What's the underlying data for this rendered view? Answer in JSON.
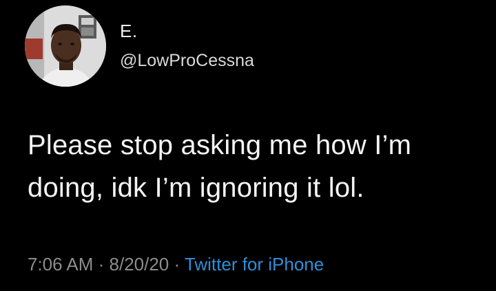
{
  "tweet": {
    "author": {
      "display_name": "E.",
      "handle": "@LowProCessna"
    },
    "text_lines": [
      "Please stop asking me how I’m",
      "doing, idk I’m ignoring it lol."
    ],
    "meta": {
      "time": "7:06 AM",
      "separator": " · ",
      "date": "8/20/20",
      "source": "Twitter for iPhone"
    }
  },
  "colors": {
    "background": "#000000",
    "text": "#f4f4f4",
    "muted": "#8d8d8d",
    "link": "#2f8fd8"
  }
}
